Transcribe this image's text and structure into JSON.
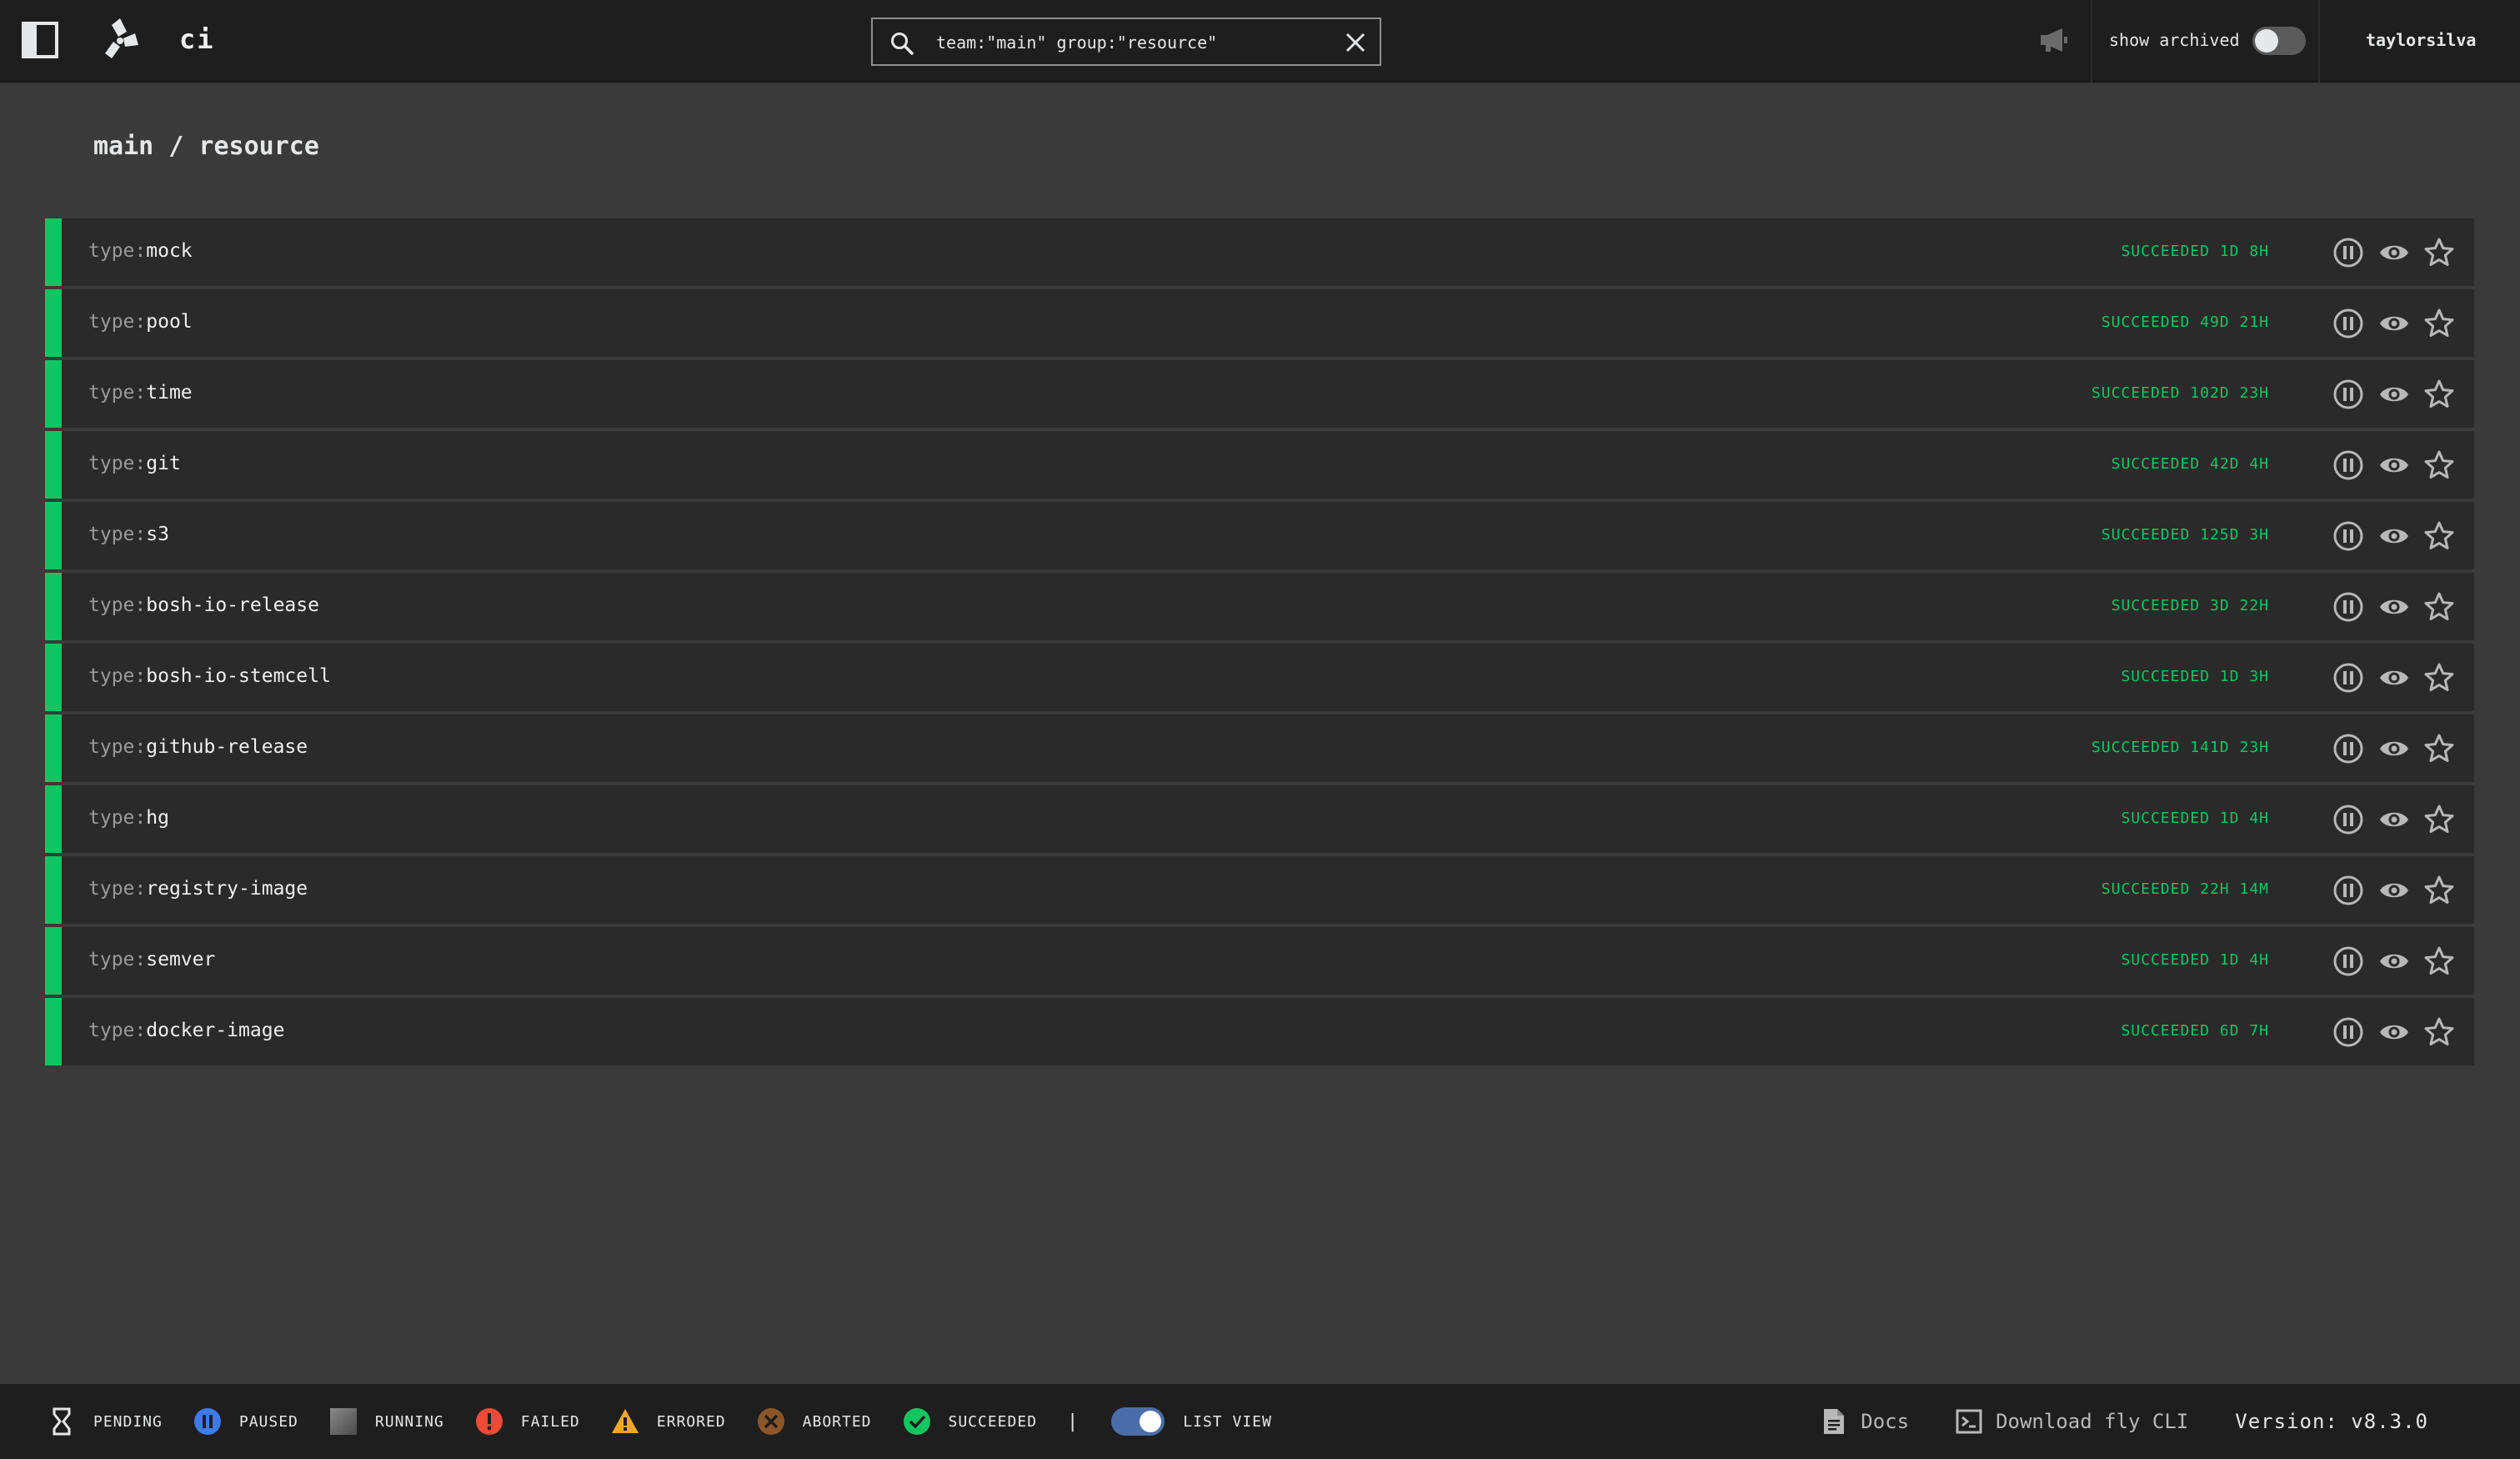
{
  "header": {
    "app_title": "ci",
    "search": {
      "value": "team:\"main\" group:\"resource\"",
      "placeholder": ""
    },
    "archived_label": "show archived",
    "username": "taylorsilva"
  },
  "breadcrumb": "main / resource",
  "rows": [
    {
      "key": "type:",
      "name": "mock",
      "status": "SUCCEEDED 1D 8H"
    },
    {
      "key": "type:",
      "name": "pool",
      "status": "SUCCEEDED 49D 21H"
    },
    {
      "key": "type:",
      "name": "time",
      "status": "SUCCEEDED 102D 23H"
    },
    {
      "key": "type:",
      "name": "git",
      "status": "SUCCEEDED 42D 4H"
    },
    {
      "key": "type:",
      "name": "s3",
      "status": "SUCCEEDED 125D 3H"
    },
    {
      "key": "type:",
      "name": "bosh-io-release",
      "status": "SUCCEEDED 3D 22H"
    },
    {
      "key": "type:",
      "name": "bosh-io-stemcell",
      "status": "SUCCEEDED 1D 3H"
    },
    {
      "key": "type:",
      "name": "github-release",
      "status": "SUCCEEDED 141D 23H"
    },
    {
      "key": "type:",
      "name": "hg",
      "status": "SUCCEEDED 1D 4H"
    },
    {
      "key": "type:",
      "name": "registry-image",
      "status": "SUCCEEDED 22H 14M"
    },
    {
      "key": "type:",
      "name": "semver",
      "status": "SUCCEEDED 1D 4H"
    },
    {
      "key": "type:",
      "name": "docker-image",
      "status": "SUCCEEDED 6D 7H"
    }
  ],
  "legend": {
    "pending": "PENDING",
    "paused": "PAUSED",
    "running": "RUNNING",
    "failed": "FAILED",
    "errored": "ERRORED",
    "aborted": "ABORTED",
    "succeeded": "SUCCEEDED",
    "separator": "|",
    "list_view": "LIST VIEW"
  },
  "footer": {
    "docs": "Docs",
    "download_cli": "Download fly CLI",
    "version": "Version: v8.3.0"
  },
  "colors": {
    "succeeded": "#11c560",
    "paused": "#3d7ce8",
    "failed": "#ed4b35",
    "errored": "#f5a623",
    "aborted": "#8b572a",
    "topbar_bg": "#1e1e1e",
    "page_bg": "#3a3a3a",
    "row_bg": "#2a2a2a"
  },
  "icons": [
    "sidebar-toggle-icon",
    "concourse-logo",
    "search-icon",
    "close-icon",
    "megaphone-icon",
    "pause-icon",
    "eye-icon",
    "star-icon",
    "hourglass-icon",
    "document-icon",
    "terminal-icon"
  ]
}
